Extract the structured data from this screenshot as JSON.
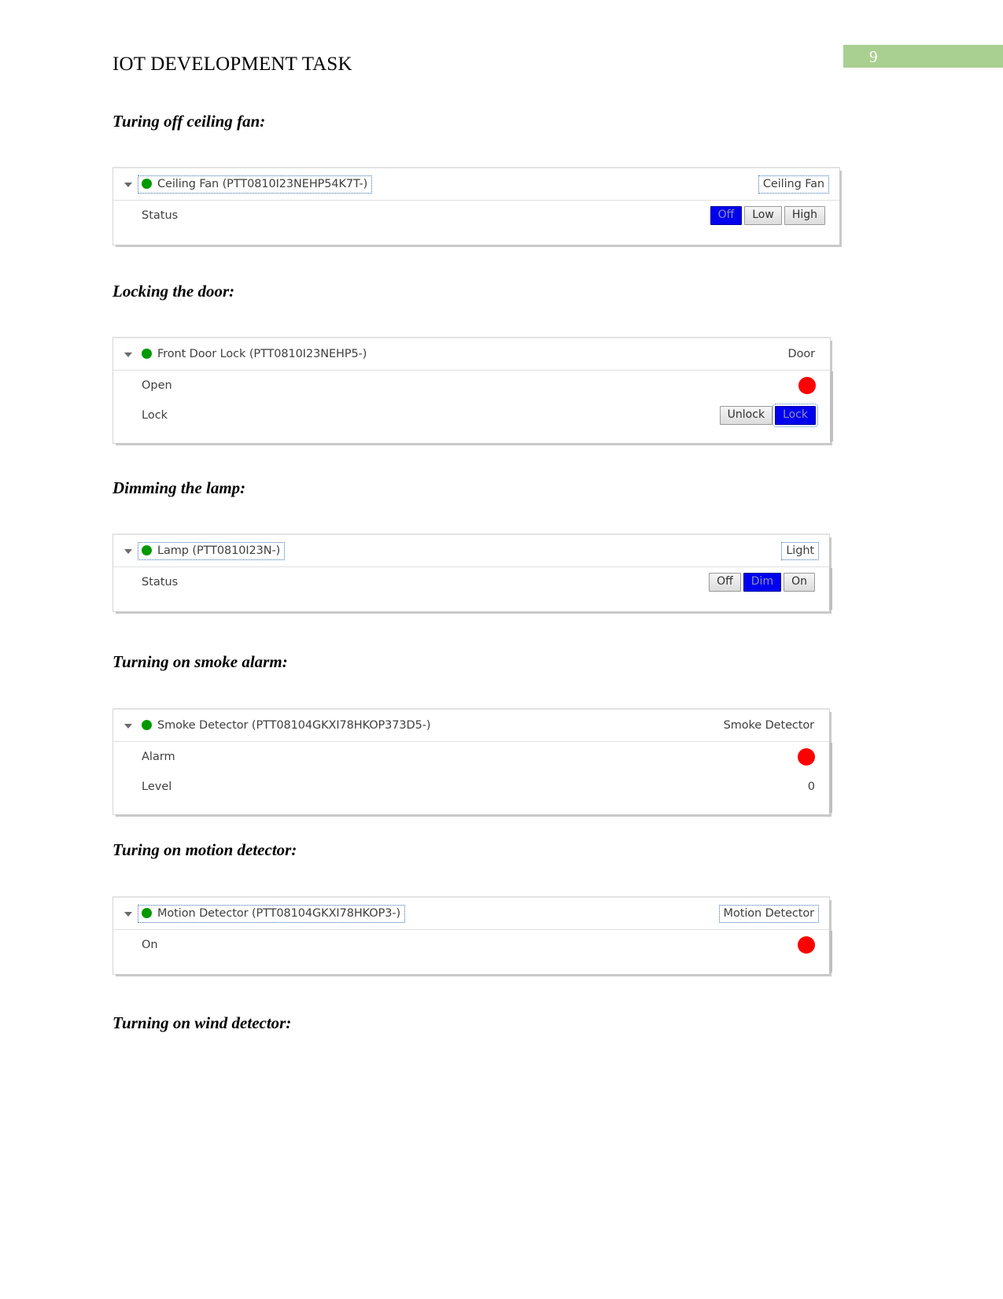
{
  "header": {
    "title": "IOT DEVELOPMENT TASK",
    "page_number": "9",
    "badge_color": "#a9cf91"
  },
  "colors": {
    "online_dot": "#009900",
    "alert_led": "#fd0000",
    "selected_button_bg": "#0000ee",
    "selected_button_text": "#8e8eb8"
  },
  "sections": [
    {
      "heading": "Turing off ceiling fan:",
      "panel": {
        "device_name": "Ceiling Fan (PTT0810I23NEHP54K7T-)",
        "device_type": "Ceiling Fan",
        "title_focused": true,
        "type_focused": true,
        "status_dot": "green",
        "rows": [
          {
            "label": "Status",
            "control": "buttons",
            "buttons": [
              {
                "label": "Off",
                "selected": true,
                "focused": false
              },
              {
                "label": "Low",
                "selected": false,
                "focused": false
              },
              {
                "label": "High",
                "selected": false,
                "focused": false
              }
            ]
          }
        ]
      }
    },
    {
      "heading": "Locking the door:",
      "panel": {
        "device_name": "Front Door Lock (PTT0810I23NEHP5-)",
        "device_type": "Door",
        "title_focused": false,
        "type_focused": false,
        "status_dot": "green",
        "rows": [
          {
            "label": "Open",
            "control": "led",
            "led": "red"
          },
          {
            "label": "Lock",
            "control": "buttons",
            "buttons": [
              {
                "label": "Unlock",
                "selected": false,
                "focused": false
              },
              {
                "label": "Lock",
                "selected": true,
                "focused": true
              }
            ]
          }
        ]
      }
    },
    {
      "heading": "Dimming the lamp:",
      "panel": {
        "device_name": "Lamp (PTT0810I23N-)",
        "device_type": "Light",
        "title_focused": true,
        "type_focused": true,
        "status_dot": "green",
        "rows": [
          {
            "label": "Status",
            "control": "buttons",
            "buttons": [
              {
                "label": "Off",
                "selected": false,
                "focused": false
              },
              {
                "label": "Dim",
                "selected": true,
                "focused": false
              },
              {
                "label": "On",
                "selected": false,
                "focused": false
              }
            ]
          }
        ]
      }
    },
    {
      "heading": "Turning on smoke alarm:",
      "panel": {
        "device_name": "Smoke Detector (PTT08104GKXI78HKOP373D5-)",
        "device_type": "Smoke Detector",
        "title_focused": false,
        "type_focused": false,
        "status_dot": "green",
        "rows": [
          {
            "label": "Alarm",
            "control": "led",
            "led": "red"
          },
          {
            "label": "Level",
            "control": "value",
            "value": "0"
          }
        ]
      }
    },
    {
      "heading": "Turing on motion detector:",
      "panel": {
        "device_name": "Motion Detector (PTT08104GKXI78HKOP3-)",
        "device_type": "Motion Detector",
        "title_focused": true,
        "type_focused": true,
        "status_dot": "green",
        "rows": [
          {
            "label": "On",
            "control": "led",
            "led": "red"
          }
        ]
      }
    },
    {
      "heading": "Turning on wind detector:",
      "panel": null
    }
  ]
}
